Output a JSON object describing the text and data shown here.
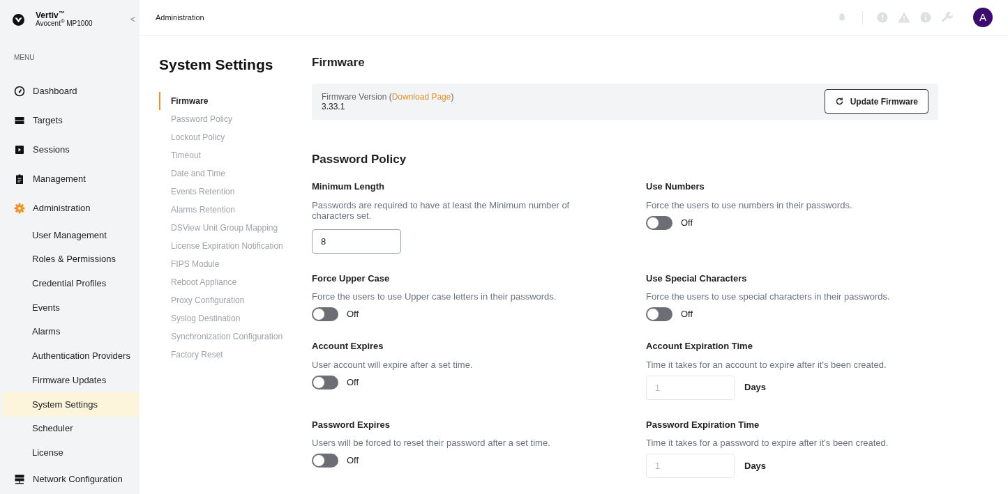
{
  "brand": {
    "name": "Vertiv$^{™}$",
    "product": "Avocent$^{®}$ MP1000",
    "collapse": "<"
  },
  "sidebar": {
    "heading": "MENU",
    "items": [
      {
        "label": "Dashboard",
        "selected": false
      },
      {
        "label": "Targets",
        "selected": false
      },
      {
        "label": "Sessions",
        "selected": false
      },
      {
        "label": "Management",
        "selected": false
      },
      {
        "label": "Administration",
        "selected": false,
        "children": [
          {
            "label": "User Management",
            "selected": false
          },
          {
            "label": "Roles & Permissions",
            "selected": false
          },
          {
            "label": "Credential Profiles",
            "selected": false
          },
          {
            "label": "Events",
            "selected": false
          },
          {
            "label": "Alarms",
            "selected": false
          },
          {
            "label": "Authentication Providers",
            "selected": false
          },
          {
            "label": "Firmware Updates",
            "selected": false
          },
          {
            "label": "System Settings",
            "selected": true
          },
          {
            "label": "Scheduler",
            "selected": false
          },
          {
            "label": "License",
            "selected": false
          }
        ]
      },
      {
        "label": "Network Configuration",
        "selected": false
      }
    ]
  },
  "header": {
    "breadcrumb": "Administration",
    "avatar": "A"
  },
  "settings_nav": {
    "title": "System Settings",
    "items": [
      {
        "label": "Firmware",
        "selected": true
      },
      {
        "label": "Password Policy",
        "selected": false
      },
      {
        "label": "Lockout Policy",
        "selected": false
      },
      {
        "label": "Timeout",
        "selected": false
      },
      {
        "label": "Date and Time",
        "selected": false
      },
      {
        "label": "Events Retention",
        "selected": false
      },
      {
        "label": "Alarms Retention",
        "selected": false
      },
      {
        "label": "DSView Unit Group Mapping",
        "selected": false
      },
      {
        "label": "License Expiration Notification",
        "selected": false
      },
      {
        "label": "FIPS Module",
        "selected": false
      },
      {
        "label": "Reboot Appliance",
        "selected": false
      },
      {
        "label": "Proxy Configuration",
        "selected": false
      },
      {
        "label": "Syslog Destination",
        "selected": false
      },
      {
        "label": "Synchronization Configuration",
        "selected": false
      },
      {
        "label": "Factory Reset",
        "selected": false
      }
    ]
  },
  "firmware": {
    "title": "Firmware",
    "label": "Firmware Version (",
    "link": "Download Page",
    "label_end": ")",
    "version": "3.33.1",
    "button": "Update Firmware"
  },
  "password_policy": {
    "title": "Password Policy",
    "fields": [
      {
        "kind": "number",
        "label": "Minimum Length",
        "description": "Passwords are required to have at least the Minimum number of characters set.",
        "value": "8"
      },
      {
        "kind": "toggle",
        "label": "Use Numbers",
        "description": "Force the users to use numbers in their passwords.",
        "on": false,
        "state": "Off"
      },
      {
        "kind": "toggle",
        "label": "Force Upper Case",
        "description": "Force the users to use Upper case letters in their passwords.",
        "on": false,
        "state": "Off"
      },
      {
        "kind": "toggle",
        "label": "Use Special Characters",
        "description": "Force the users to use special characters in their passwords.",
        "on": false,
        "state": "Off"
      },
      {
        "kind": "toggle",
        "label": "Account Expires",
        "description": "User account will expire after a set time.",
        "on": false,
        "state": "Off"
      },
      {
        "kind": "days",
        "label": "Account Expiration Time",
        "description": "Time it takes for an account to expire after it's been created.",
        "placeholder": "1",
        "disabled": true,
        "unit": "Days"
      },
      {
        "kind": "toggle",
        "label": "Password Expires",
        "description": "Users will be forced to reset their password after a set time.",
        "on": false,
        "state": "Off"
      },
      {
        "kind": "days",
        "label": "Password Expiration Time",
        "description": "Time it takes for a password to expire after it's been created.",
        "placeholder": "1",
        "disabled": true,
        "unit": "Days"
      }
    ]
  }
}
